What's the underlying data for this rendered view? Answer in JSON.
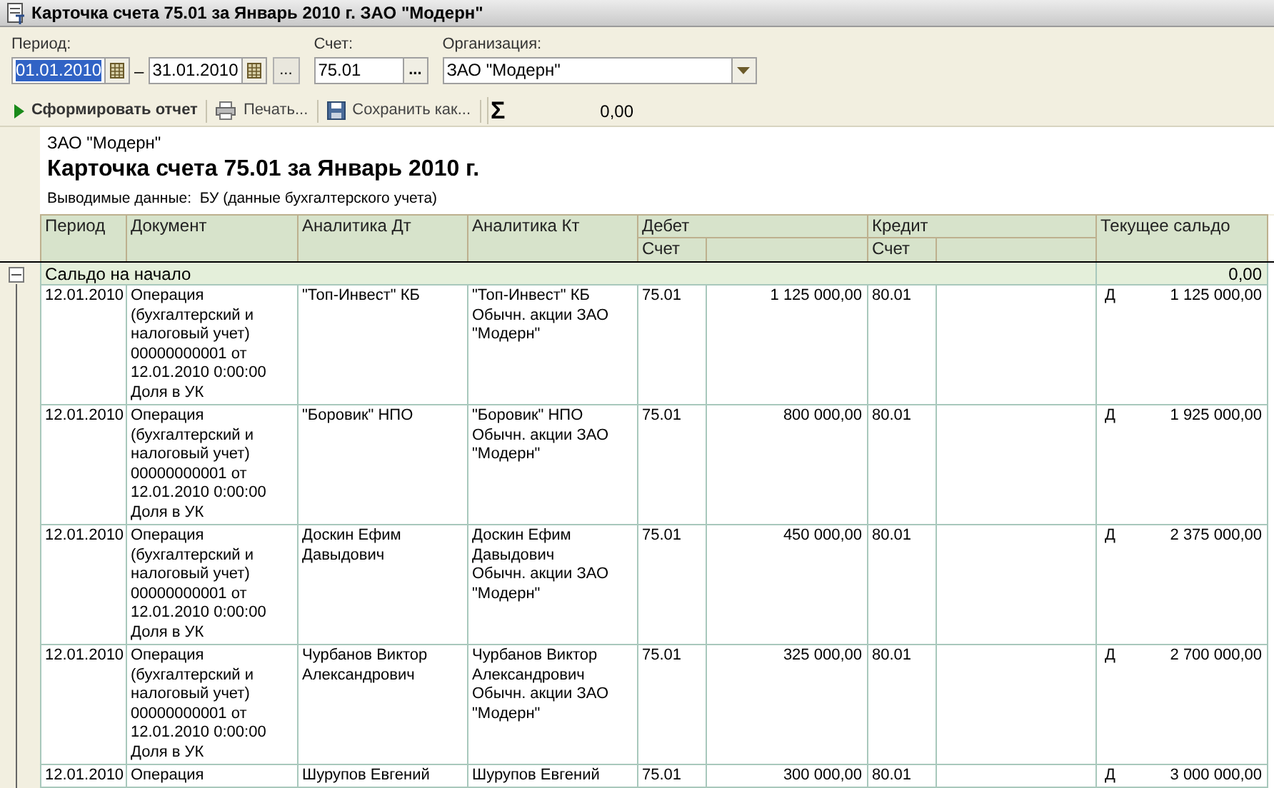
{
  "window": {
    "title": "Карточка счета 75.01 за Январь 2010 г. ЗАО \"Модерн\""
  },
  "filters": {
    "period_label": "Период:",
    "period_from": {
      "value": "01.01.2010",
      "text_selected": true
    },
    "dash": "–",
    "period_to": {
      "value": "31.01.2010",
      "text_selected": false
    },
    "period_button": "...",
    "account_label": "Счет:",
    "account": {
      "value": "75.01"
    },
    "account_button": "...",
    "organization_label": "Организация:",
    "organization": {
      "value": "ЗАО \"Модерн\""
    }
  },
  "toolbar": {
    "buttons": [
      {
        "kind": "generate",
        "label": "Сформировать отчет"
      },
      {
        "kind": "print",
        "label": "Печать..."
      },
      {
        "kind": "save",
        "label": "Сохранить как..."
      }
    ],
    "sum_symbol": "Σ",
    "sum_value": "0,00"
  },
  "report": {
    "organization": "ЗАО \"Модерн\"",
    "title": "Карточка счета 75.01 за Январь 2010 г.",
    "output_note": "Выводимые данные:  БУ (данные бухгалтерского учета)",
    "columns": {
      "period": "Период",
      "document": "Документ",
      "analytics_dt": "Аналитика Дт",
      "analytics_kt": "Аналитика Кт",
      "debit": "Дебет",
      "debit_account": "Счет",
      "credit": "Кредит",
      "credit_account": "Счет",
      "balance": "Текущее сальдо"
    },
    "opening_row": {
      "label": "Сальдо на начало",
      "balance": "0,00",
      "expanded": true
    },
    "rows": [
      {
        "period": "12.01.2010",
        "document": [
          "Операция",
          "(бухгалтерский и",
          "налоговый учет)",
          "00000000001 от",
          "12.01.2010 0:00:00",
          "Доля в УК"
        ],
        "analytics_dt": [
          "\"Топ-Инвест\" КБ"
        ],
        "analytics_kt": [
          "\"Топ-Инвест\" КБ",
          "Обычн. акции ЗАО",
          "\"Модерн\""
        ],
        "debit_account": "75.01",
        "debit_amount": "1 125 000,00",
        "credit_account": "80.01",
        "balance_side": "Д",
        "balance_amount": "1 125 000,00"
      },
      {
        "period": "12.01.2010",
        "document": [
          "Операция",
          "(бухгалтерский и",
          "налоговый учет)",
          "00000000001 от",
          "12.01.2010 0:00:00",
          "Доля в УК"
        ],
        "analytics_dt": [
          "\"Боровик\" НПО"
        ],
        "analytics_kt": [
          "\"Боровик\" НПО",
          "Обычн. акции ЗАО",
          "\"Модерн\""
        ],
        "debit_account": "75.01",
        "debit_amount": "800 000,00",
        "credit_account": "80.01",
        "balance_side": "Д",
        "balance_amount": "1 925 000,00"
      },
      {
        "period": "12.01.2010",
        "document": [
          "Операция",
          "(бухгалтерский и",
          "налоговый учет)",
          "00000000001 от",
          "12.01.2010 0:00:00",
          "Доля в УК"
        ],
        "analytics_dt": [
          "Доскин Ефим",
          "Давыдович"
        ],
        "analytics_kt": [
          "Доскин Ефим",
          "Давыдович",
          "Обычн. акции ЗАО",
          "\"Модерн\""
        ],
        "debit_account": "75.01",
        "debit_amount": "450 000,00",
        "credit_account": "80.01",
        "balance_side": "Д",
        "balance_amount": "2 375 000,00"
      },
      {
        "period": "12.01.2010",
        "document": [
          "Операция",
          "(бухгалтерский и",
          "налоговый учет)",
          "00000000001 от",
          "12.01.2010 0:00:00",
          "Доля в УК"
        ],
        "analytics_dt": [
          "Чурбанов Виктор",
          "Александрович"
        ],
        "analytics_kt": [
          "Чурбанов Виктор",
          "Александрович",
          "Обычн. акции ЗАО",
          "\"Модерн\""
        ],
        "debit_account": "75.01",
        "debit_amount": "325 000,00",
        "credit_account": "80.01",
        "balance_side": "Д",
        "balance_amount": "2 700 000,00"
      },
      {
        "period": "12.01.2010",
        "document": [
          "Операция"
        ],
        "analytics_dt": [
          "Шурупов Евгений"
        ],
        "analytics_kt": [
          "Шурупов Евгений"
        ],
        "debit_account": "75.01",
        "debit_amount": "300 000,00",
        "credit_account": "80.01",
        "balance_side": "Д",
        "balance_amount": "3 000 000,00"
      }
    ]
  }
}
